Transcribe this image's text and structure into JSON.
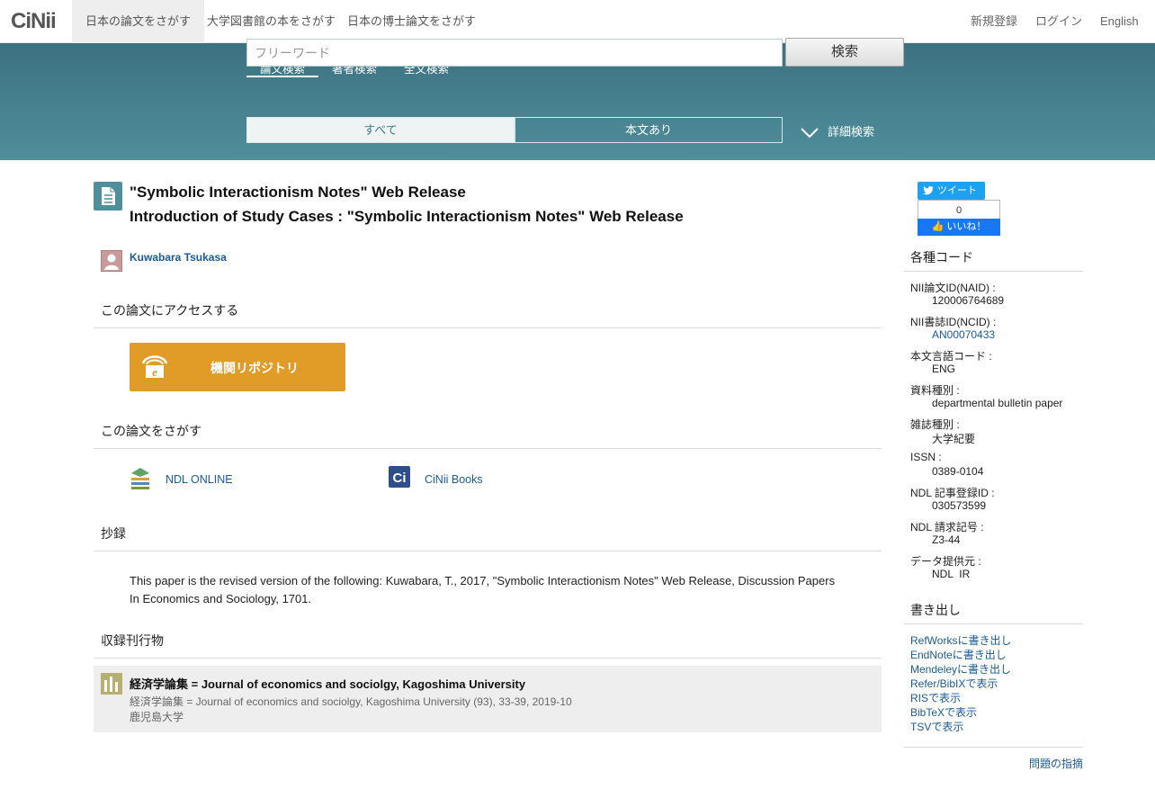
{
  "header": {
    "logo_main": "CiNii",
    "tabs": [
      "日本の論文をさがす",
      "大学図書館の本をさがす",
      "日本の博士論文をさがす"
    ],
    "right_links": [
      "新規登録",
      "ログイン",
      "English"
    ]
  },
  "search": {
    "tabs": [
      "論文検索",
      "著者検索",
      "全文検索"
    ],
    "placeholder": "フリーワード",
    "button": "検索",
    "filters": [
      "すべて",
      "本文あり"
    ],
    "advanced": "詳細検索"
  },
  "article": {
    "title": "\"Symbolic Interactionism Notes\" Web Release",
    "subtitle": "Introduction of Study Cases : \"Symbolic Interactionism Notes\" Web Release",
    "author": "Kuwabara Tsukasa"
  },
  "sections": {
    "access": "この論文にアクセスする",
    "find": "この論文をさがす",
    "abstract": "抄録",
    "publication": "収録刊行物"
  },
  "access_button": "機関リポジトリ",
  "find_links": [
    "NDL ONLINE",
    "CiNii Books"
  ],
  "abstract_text": "This paper is the revised version of the following: Kuwabara, T., 2017, \"Symbolic Interactionism Notes\" Web Release, Discussion Papers In Economics and Sociology, 1701.",
  "journal": {
    "title": "経済学論集 = Journal of economics and sociolgy, Kagoshima University",
    "detail": "経済学論集 = Journal of economics and sociolgy, Kagoshima University (93), 33-39, 2019-10",
    "publisher": "鹿児島大学"
  },
  "social": {
    "tweet": "ツイート",
    "like_count": "0",
    "like": "いいね！"
  },
  "codes": {
    "heading": "各種コード",
    "items": [
      {
        "label": "NII論文ID(NAID) :",
        "value": "120006764689"
      },
      {
        "label": "NII書誌ID(NCID) :",
        "value": "AN00070433"
      },
      {
        "label": "本文言語コード :",
        "value": "ENG"
      },
      {
        "label": "資料種別 :",
        "value": "departmental bulletin paper"
      },
      {
        "label": "雑誌種別 :",
        "value": "大学紀要"
      },
      {
        "label": "ISSN :",
        "value": "0389-0104"
      },
      {
        "label": "NDL 記事登録ID :",
        "value": "030573599"
      },
      {
        "label": "NDL 請求記号 :",
        "value": "Z3-44"
      },
      {
        "label": "データ提供元 :",
        "value": "NDL  IR"
      }
    ]
  },
  "export": {
    "heading": "書き出し",
    "links": [
      "RefWorksに書き出し",
      "EndNoteに書き出し",
      "Mendeleyに書き出し",
      "Refer/BibIXで表示",
      "RISで表示",
      "BibTeXで表示",
      "TSVで表示"
    ]
  },
  "report_link": "問題の指摘",
  "colors": {
    "band": "#4f8e9b",
    "repo_button": "#e09c27",
    "link": "#1a5b96"
  }
}
